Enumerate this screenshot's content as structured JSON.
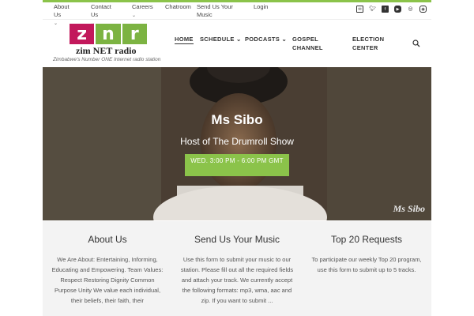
{
  "topnav": {
    "items": [
      {
        "label": "About Us",
        "caret": "⌄"
      },
      {
        "label": "Contact Us",
        "caret": "⌄"
      },
      {
        "label": "Careers",
        "caret": "⌄"
      },
      {
        "label": "Chatroom"
      },
      {
        "label": "Send Us Your Music"
      },
      {
        "label": "Login"
      }
    ]
  },
  "social": [
    "email-icon",
    "twitter-icon",
    "facebook-icon",
    "youtube-icon",
    "soundcloud-icon",
    "instagram-icon"
  ],
  "logo": {
    "letters": [
      "z",
      "n",
      "r"
    ],
    "name": "zim NET radio",
    "tagline": "Zimbabwe's Number ONE Internet radio station"
  },
  "mainnav": {
    "items": [
      {
        "label": "HOME"
      },
      {
        "label": "SCHEDULE",
        "caret": "⌄"
      },
      {
        "label": "PODCASTS",
        "caret": "⌄"
      },
      {
        "label": "GOSPEL CHANNEL"
      },
      {
        "label": "ELECTION CENTER"
      }
    ]
  },
  "hero": {
    "title": "Ms Sibo",
    "subtitle": "Host of The Drumroll Show",
    "button": "WED. 3:00 PM - 6:00 PM GMT",
    "watermark": "Ms Sibo"
  },
  "columns": [
    {
      "title": "About Us",
      "text": "We Are About: Entertaining, Informing, Educating and Empowering. Team Values: Respect Restoring Dignity Common Purpose Unity We value each individual, their beliefs, their faith, their"
    },
    {
      "title": "Send Us Your Music",
      "text": "Use this form to submit your music to our station. Please fill out all the required fields and attach your track. We currently accept the following formats: mp3, wma, aac and zip. If you want to submit ..."
    },
    {
      "title": "Top 20 Requests",
      "text": "To participate our weekly Top 20 program, use this form to submit up to 5 tracks."
    }
  ],
  "colors": {
    "accent": "#8bc34a",
    "logo_z": "#c2185b"
  }
}
